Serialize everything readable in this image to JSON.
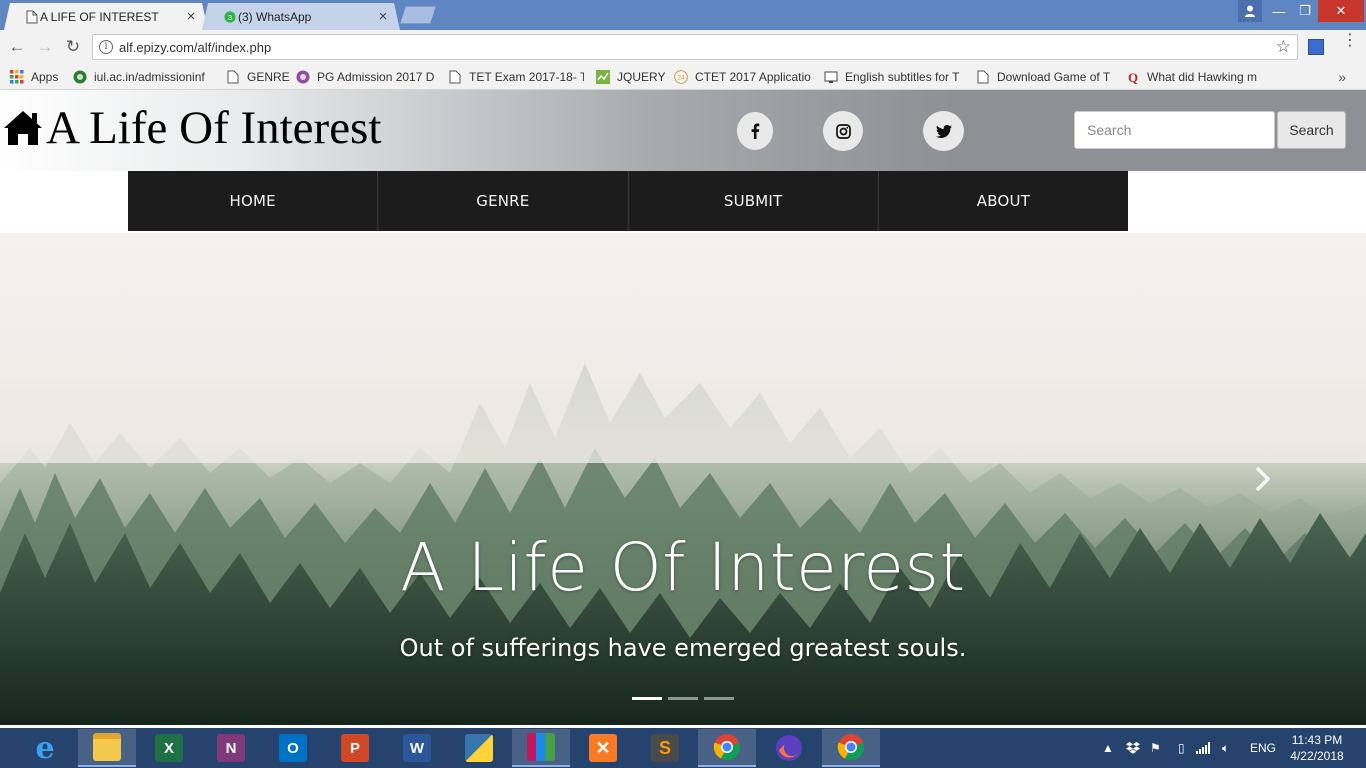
{
  "browser": {
    "tabs": [
      {
        "title": "A LIFE OF INTEREST",
        "active": true,
        "icon": "page-icon"
      },
      {
        "title": "(3) WhatsApp",
        "active": false,
        "icon": "whatsapp-icon",
        "badge": "3"
      }
    ],
    "url": "alf.epizy.com/alf/index.php",
    "bookmarks": [
      {
        "label": "Apps",
        "icon": "apps-grid-icon"
      },
      {
        "label": "iul.ac.in/admissioninf",
        "icon": "emblem-icon"
      },
      {
        "label": "GENRE",
        "icon": "page-icon"
      },
      {
        "label": "PG Admission 2017 D",
        "icon": "emblem-icon"
      },
      {
        "label": "TET Exam 2017-18- T",
        "icon": "page-icon"
      },
      {
        "label": "JQUERY",
        "icon": "chart-icon"
      },
      {
        "label": "CTET 2017 Applicatio",
        "icon": "badge-24-icon"
      },
      {
        "label": "English subtitles for T",
        "icon": "monitor-icon"
      },
      {
        "label": "Download Game of T",
        "icon": "page-icon"
      },
      {
        "label": "What did Hawking m",
        "icon": "quora-icon"
      }
    ],
    "bookmarks_more": "»"
  },
  "site": {
    "logo_text": "A Life Of Interest",
    "social": [
      "facebook-icon",
      "instagram-icon",
      "twitter-icon"
    ],
    "search_placeholder": "Search",
    "search_button": "Search",
    "nav": [
      "HOME",
      "GENRE",
      "SUBMIT",
      "ABOUT"
    ],
    "hero": {
      "title": "A Life Of Interest",
      "subtitle": "Out of sufferings have emerged greatest souls.",
      "slide_count": 3,
      "active_slide": 0
    }
  },
  "taskbar": {
    "apps": [
      "internet-explorer-icon",
      "file-explorer-icon",
      "excel-icon",
      "onenote-icon",
      "outlook-icon",
      "powerpoint-icon",
      "word-icon",
      "python-icon",
      "winrar-icon",
      "xampp-icon",
      "sublime-text-icon",
      "chrome-icon",
      "firefox-icon",
      "chrome-icon"
    ],
    "language": "ENG",
    "time": "11:43 PM",
    "date": "4/22/2018"
  },
  "colors": {
    "tabstrip": "#5f85c3",
    "nav_bg": "#1c1c1c",
    "taskbar": "#26436e"
  }
}
